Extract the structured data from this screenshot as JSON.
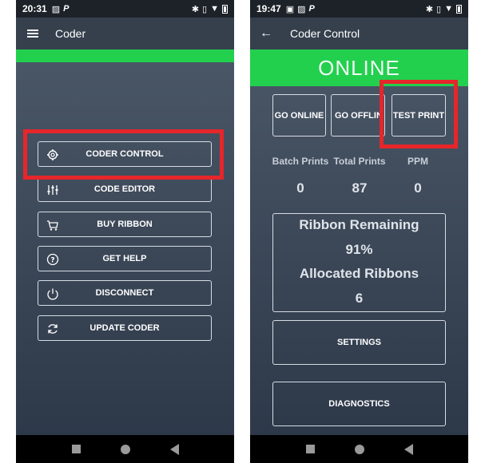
{
  "left_phone": {
    "status": {
      "time": "20:31"
    },
    "app_bar": {
      "title": "Coder"
    },
    "menu": [
      {
        "label": "CODER CONTROL",
        "icon": "gear-icon"
      },
      {
        "label": "CODE EDITOR",
        "icon": "sliders-icon"
      },
      {
        "label": "BUY RIBBON",
        "icon": "cart-icon"
      },
      {
        "label": "GET HELP",
        "icon": "help-icon"
      },
      {
        "label": "DISCONNECT",
        "icon": "power-icon"
      },
      {
        "label": "UPDATE CODER",
        "icon": "refresh-icon"
      }
    ]
  },
  "right_phone": {
    "status": {
      "time": "19:47"
    },
    "app_bar": {
      "title": "Coder Control"
    },
    "state_banner": "ONLINE",
    "controls": {
      "go_online": "GO ONLINE",
      "go_offline": "GO OFFLIN",
      "test_print": "TEST PRINT"
    },
    "stats": {
      "batch_prints": {
        "label": "Batch Prints",
        "value": "0"
      },
      "total_prints": {
        "label": "Total Prints",
        "value": "87"
      },
      "ppm": {
        "label": "PPM",
        "value": "0"
      }
    },
    "ribbon": {
      "remaining_label": "Ribbon Remaining",
      "remaining_value": "91%",
      "allocated_label": "Allocated Ribbons",
      "allocated_value": "6"
    },
    "settings_label": "SETTINGS",
    "diagnostics_label": "DIAGNOSTICS"
  },
  "colors": {
    "accent_green": "#22d04e",
    "highlight_red": "#e6262a",
    "panel_dark": "#36404d"
  }
}
